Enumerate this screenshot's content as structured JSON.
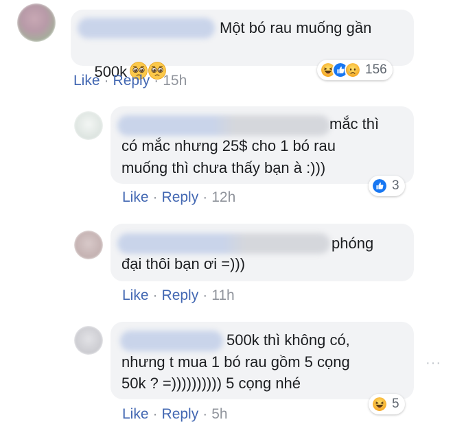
{
  "comments": [
    {
      "id": "c1",
      "text_line1": "Một bó rau muống gần",
      "text_line2_prefix": "500k",
      "actions": {
        "like": "Like",
        "reply": "Reply",
        "time": "15h"
      },
      "reactions": {
        "icons": [
          "haha-icon",
          "like-icon",
          "sad-icon"
        ],
        "count": "156"
      }
    },
    {
      "id": "c2",
      "text_line1": "mắc thì",
      "text_line2": "có mắc nhưng 25$ cho 1 bó rau",
      "text_line3": "muống thì chưa thấy bạn à :)))",
      "actions": {
        "like": "Like",
        "reply": "Reply",
        "time": "12h"
      },
      "reactions": {
        "icons": [
          "like-icon"
        ],
        "count": "3"
      }
    },
    {
      "id": "c3",
      "text_line1": "phóng",
      "text_line2": "đại thôi bạn ơi =)))",
      "actions": {
        "like": "Like",
        "reply": "Reply",
        "time": "11h"
      }
    },
    {
      "id": "c4",
      "text_line1": "500k thì không có,",
      "text_line2": "nhưng t mua 1 bó rau gồm 5 cọng",
      "text_line3": "50k ? =)))))))))) 5 cọng nhé",
      "actions": {
        "like": "Like",
        "reply": "Reply",
        "time": "5h"
      },
      "reactions": {
        "icons": [
          "haha-icon"
        ],
        "count": "5"
      }
    }
  ],
  "more_options": "···",
  "colors": {
    "bubble": "#f2f3f5",
    "link": "#4267b2",
    "meta": "#90949c",
    "like_blue": "#1877f2",
    "haha_yellow": "#f7b125"
  }
}
